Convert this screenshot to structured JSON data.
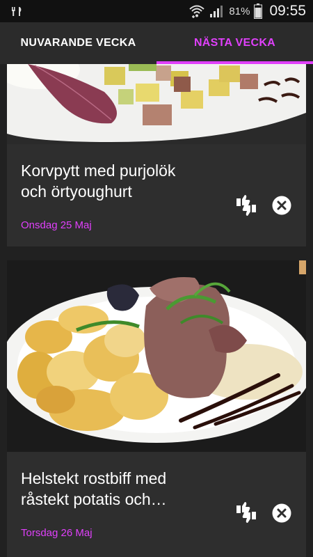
{
  "status_bar": {
    "left_icon": "notification-utensils-icon",
    "wifi_icon": "wifi-icon",
    "signal_icon": "signal-icon",
    "battery_percent": "81%",
    "battery_icon": "battery-icon",
    "time": "09:55"
  },
  "tabs": [
    {
      "label": "NUVARANDE VECKA",
      "selected": false
    },
    {
      "label": "NÄSTA VECKA",
      "selected": true
    }
  ],
  "accent_color": "#e040fb",
  "meals": [
    {
      "title_line1": "Korvpytt med purjolök",
      "title_line2": "och örtyoughurt",
      "date": "Onsdag 25 Maj",
      "rate_icon": "thumbs-up-down-icon",
      "dismiss_icon": "close-circle-icon"
    },
    {
      "title_line1": "Helstekt rostbiff med",
      "title_line2": "råstekt potatis och…",
      "date": "Torsdag 26 Maj",
      "rate_icon": "thumbs-up-down-icon",
      "dismiss_icon": "close-circle-icon"
    }
  ]
}
